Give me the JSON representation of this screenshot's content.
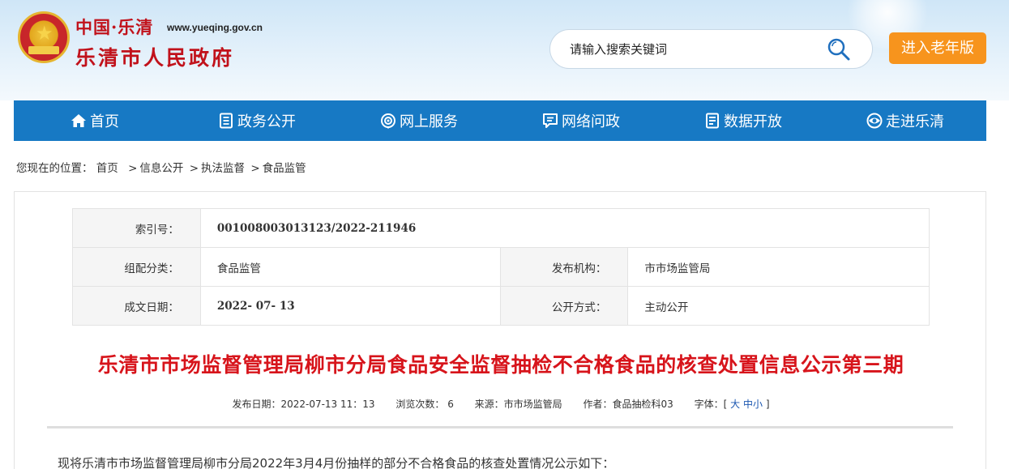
{
  "header": {
    "logo_top": "中国·乐清",
    "logo_url": "www.yueqing.gov.cn",
    "logo_main": "乐清市人民政府",
    "search_placeholder": "请输入搜索关键词",
    "elder_button": "进入老年版"
  },
  "nav": {
    "items": [
      {
        "label": "首页",
        "icon": "home-icon"
      },
      {
        "label": "政务公开",
        "icon": "document-icon"
      },
      {
        "label": "网上服务",
        "icon": "service-icon"
      },
      {
        "label": "网络问政",
        "icon": "chat-icon"
      },
      {
        "label": "数据开放",
        "icon": "data-icon"
      },
      {
        "label": "走进乐清",
        "icon": "eye-icon"
      }
    ]
  },
  "breadcrumb": {
    "prefix": "您现在的位置：",
    "items": [
      "首页",
      "信息公开",
      "执法监督",
      "食品监管"
    ],
    "separator": ">"
  },
  "meta": {
    "index_label": "索引号：",
    "index_value": "001008003013123/2022-211946",
    "category_label": "组配分类：",
    "category_value": "食品监管",
    "publisher_label": "发布机构：",
    "publisher_value": "市市场监管局",
    "date_label": "成文日期：",
    "date_value": "2022- 07- 13",
    "mode_label": "公开方式：",
    "mode_value": "主动公开"
  },
  "article": {
    "title": "乐清市市场监督管理局柳市分局食品安全监督抽检不合格食品的核查处置信息公示第三期",
    "publish_date": "发布日期：2022-07-13 11：13",
    "views": "浏览次数：  6",
    "source": "来源：市市场监管局",
    "author": "作者：食品抽检科03",
    "font_label": "字体：",
    "font_open": "[",
    "font_large": "大",
    "font_medium": "中",
    "font_small": "小",
    "font_close": "]",
    "intro": "现将乐清市市场监督管理局柳市分局2022年3月4月份抽样的部分不合格食品的核查处置情况公示如下："
  },
  "colors": {
    "nav_bg": "#1779c4",
    "title_red": "#d7141b",
    "elder_orange": "#f7941d"
  }
}
